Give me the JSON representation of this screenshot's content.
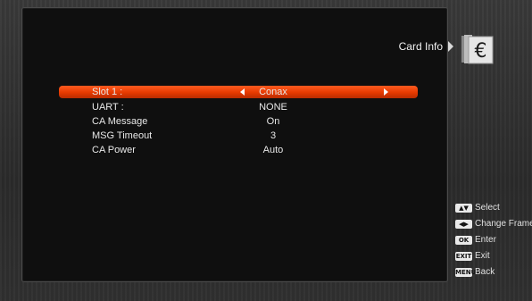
{
  "header": {
    "title": "Card Info",
    "icon": "card-euro-icon"
  },
  "menu": {
    "rows": [
      {
        "label": "Slot 1 :",
        "value": "Conax",
        "selected": true
      },
      {
        "label": "UART :",
        "value": "NONE",
        "selected": false
      },
      {
        "label": "CA Message",
        "value": "On",
        "selected": false
      },
      {
        "label": "MSG Timeout",
        "value": "3",
        "selected": false
      },
      {
        "label": "CA Power",
        "value": "Auto",
        "selected": false
      }
    ]
  },
  "help": [
    {
      "key": "▲▼",
      "label": "Select"
    },
    {
      "key": "◀▶",
      "label": "Change Frame"
    },
    {
      "key": "OK",
      "label": "Enter"
    },
    {
      "key": "EXIT",
      "label": "Exit"
    },
    {
      "key": "MENU",
      "label": "Back"
    }
  ],
  "colors": {
    "highlight": "#e84a10",
    "panel": "#0f0f0f",
    "background": "#2e2e2e"
  }
}
